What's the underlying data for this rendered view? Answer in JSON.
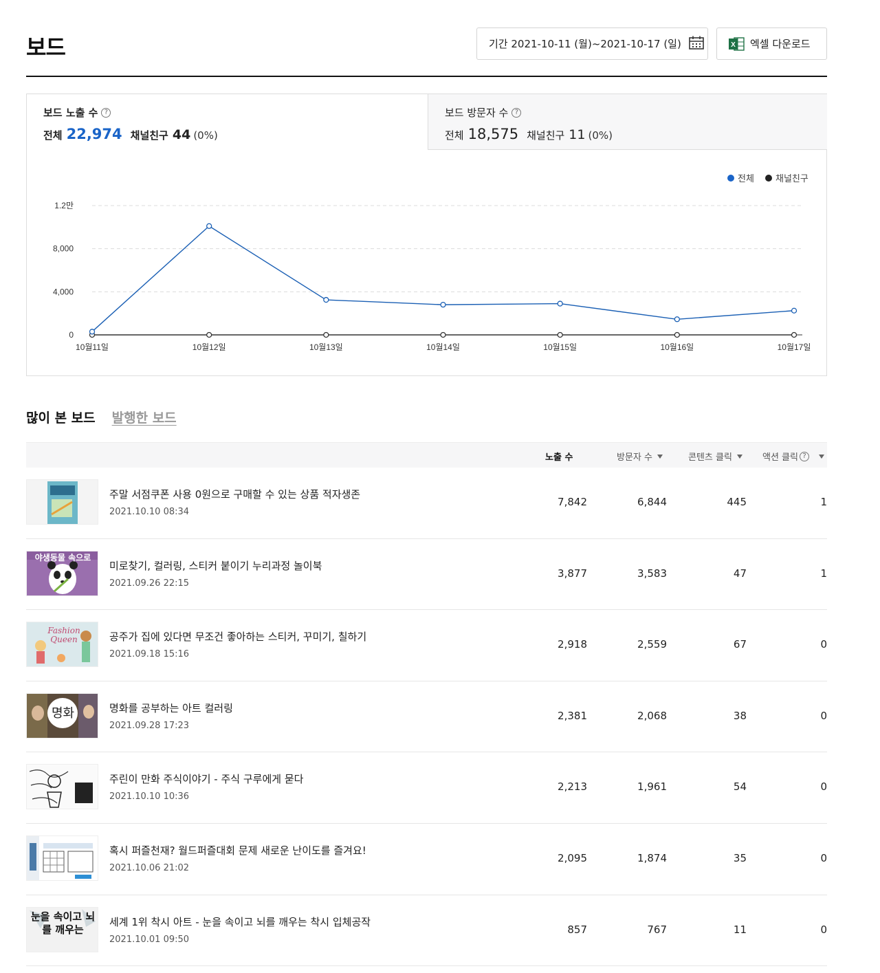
{
  "header": {
    "title": "보드",
    "period_label": "기간 2021-10-11 (월)~2021-10-17 (일)",
    "excel_label": "엑셀 다운로드"
  },
  "stats": {
    "impressions": {
      "label": "보드 노출 수",
      "total_label": "전체",
      "total": "22,974",
      "friend_label": "채널친구",
      "friend": "44",
      "friend_pct": "(0%)"
    },
    "visitors": {
      "label": "보드 방문자 수",
      "total_label": "전체",
      "total": "18,575",
      "friend_label": "채널친구",
      "friend": "11",
      "friend_pct": "(0%)"
    }
  },
  "chart_data": {
    "type": "line",
    "categories": [
      "10월11일",
      "10월12일",
      "10월13일",
      "10월14일",
      "10월15일",
      "10월16일",
      "10월17일"
    ],
    "series": [
      {
        "name": "전체",
        "color": "#1a5fb4",
        "values": [
          300,
          10100,
          3250,
          2800,
          2900,
          1450,
          2250
        ]
      },
      {
        "name": "채널친구",
        "color": "#333333",
        "values": [
          0,
          0,
          0,
          0,
          0,
          0,
          0
        ]
      }
    ],
    "y_ticks": [
      "0",
      "4,000",
      "8,000",
      "1.2만"
    ],
    "y_tick_values": [
      0,
      4000,
      8000,
      12000
    ],
    "ylim": [
      0,
      12000
    ],
    "legend": "top-right",
    "grid": true
  },
  "section_tabs": {
    "popular": "많이 본 보드",
    "published": "발행한 보드"
  },
  "table": {
    "headers": {
      "impressions": "노출 수",
      "visitors": "방문자 수",
      "content_click": "콘텐츠 클릭",
      "action_click": "액션 클릭"
    },
    "rows": [
      {
        "title": "주말 서점쿠폰 사용 0원으로 구매할 수 있는 상품 적자생존",
        "date": "2021.10.10 08:34",
        "impressions": "7,842",
        "visitors": "6,844",
        "content_click": "445",
        "action_click": "1",
        "thumb": "book-thumb-1"
      },
      {
        "title": "미로찾기, 컬러링, 스티커 붙이기 누리과정 놀이북",
        "date": "2021.09.26 22:15",
        "impressions": "3,877",
        "visitors": "3,583",
        "content_click": "47",
        "action_click": "1",
        "thumb": "book-thumb-2",
        "thumb_text": "야생동물 속으로"
      },
      {
        "title": "공주가 집에 있다면 무조건 좋아하는 스티커, 꾸미기, 칠하기",
        "date": "2021.09.18 15:16",
        "impressions": "2,918",
        "visitors": "2,559",
        "content_click": "67",
        "action_click": "0",
        "thumb": "book-thumb-3",
        "thumb_text": "Fashion Queen"
      },
      {
        "title": "명화를 공부하는 아트 컬러링",
        "date": "2021.09.28 17:23",
        "impressions": "2,381",
        "visitors": "2,068",
        "content_click": "38",
        "action_click": "0",
        "thumb": "book-thumb-4",
        "thumb_text": "명화"
      },
      {
        "title": "주린이 만화 주식이야기 - 주식 구루에게 묻다",
        "date": "2021.10.10 10:36",
        "impressions": "2,213",
        "visitors": "1,961",
        "content_click": "54",
        "action_click": "0",
        "thumb": "book-thumb-5"
      },
      {
        "title": "혹시 퍼즐천재? 월드퍼즐대회 문제 새로운 난이도를 즐겨요!",
        "date": "2021.10.06 21:02",
        "impressions": "2,095",
        "visitors": "1,874",
        "content_click": "35",
        "action_click": "0",
        "thumb": "book-thumb-6"
      },
      {
        "title": "세계 1위 착시 아트 - 눈을 속이고 뇌를 깨우는 착시 입체공작",
        "date": "2021.10.01 09:50",
        "impressions": "857",
        "visitors": "767",
        "content_click": "11",
        "action_click": "0",
        "thumb": "book-thumb-7",
        "thumb_text": "눈을 속이고 뇌를 깨우는"
      }
    ]
  },
  "icons": {
    "calendar": "calendar-icon",
    "excel": "excel-icon",
    "help": "question-icon",
    "sort": "sort-caret-icon"
  },
  "colors": {
    "accent": "#1a64c8",
    "line": "#1a5fb4",
    "border": "#dddddd"
  }
}
